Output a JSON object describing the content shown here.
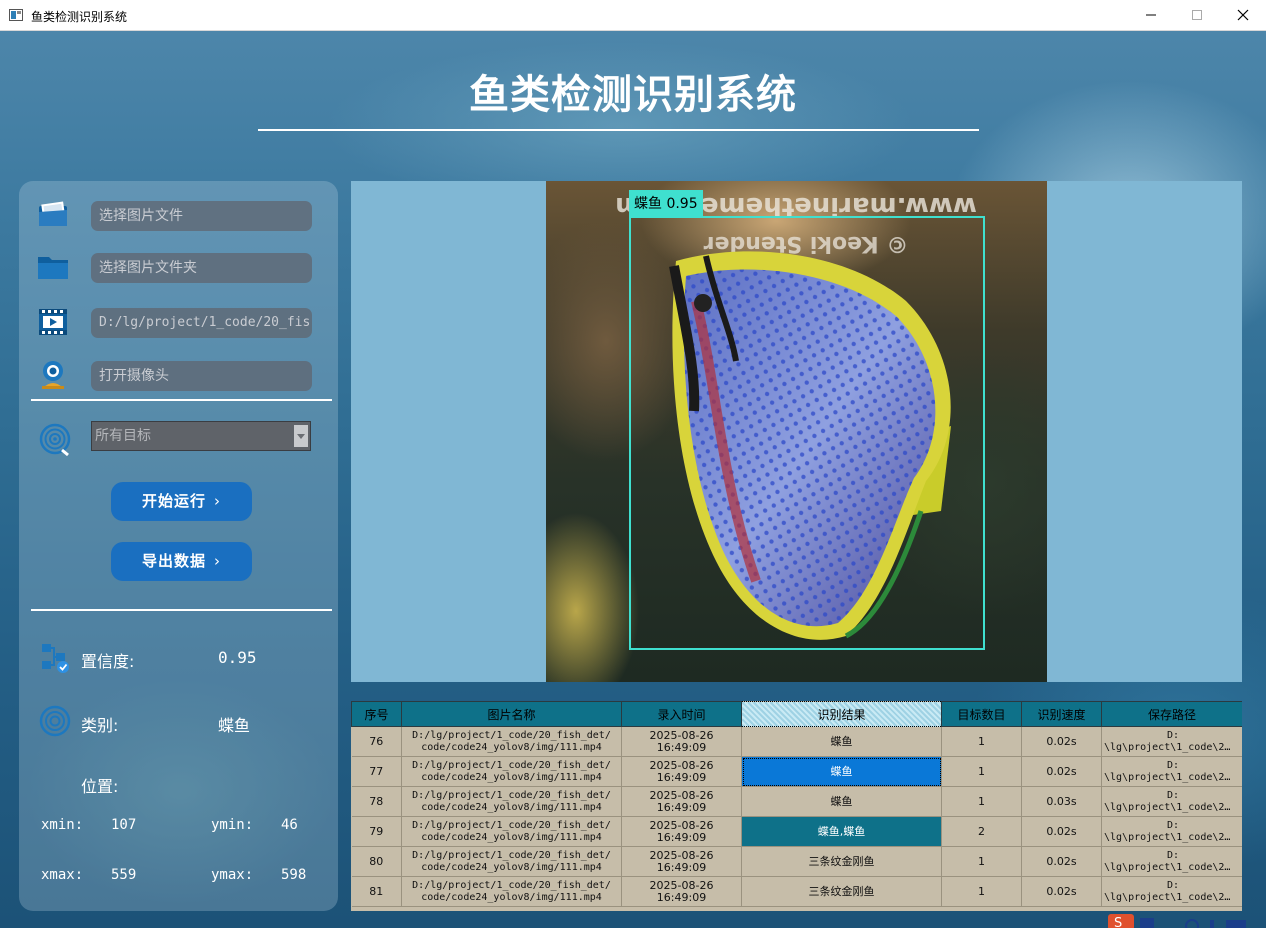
{
  "window": {
    "title": "鱼类检测识别系统"
  },
  "header": {
    "title": "鱼类检测识别系统"
  },
  "sources": {
    "image_file_placeholder": "选择图片文件",
    "image_folder_placeholder": "选择图片文件夹",
    "video_value": "D:/lg/project/1_code/20_fis",
    "camera_placeholder": "打开摄像头"
  },
  "target_select": {
    "selected": "所有目标"
  },
  "buttons": {
    "run": "开始运行",
    "export": "导出数据",
    "chevron": "›"
  },
  "result": {
    "confidence_label": "置信度:",
    "confidence_value": "0.95",
    "class_label": "类别:",
    "class_value": "蝶鱼",
    "position_label": "位置:",
    "xmin_label": "xmin:",
    "xmin_value": "107",
    "ymin_label": "ymin:",
    "ymin_value": "46",
    "xmax_label": "xmax:",
    "xmax_value": "559",
    "ymax_label": "ymax:",
    "ymax_value": "598"
  },
  "detection": {
    "label": "蝶鱼 0.95",
    "box_color": "#3fe0cf"
  },
  "image": {
    "watermark_line1": "www.marinethemes.com",
    "watermark_line2": "© Keoki Stender"
  },
  "table": {
    "columns": [
      "序号",
      "图片名称",
      "录入时间",
      "识别结果",
      "目标数目",
      "识别速度",
      "保存路径"
    ],
    "rows": [
      {
        "id": "76",
        "name_l1": "D:/lg/project/1_code/20_fish_det/",
        "name_l2": "code/code24_yolov8/img/111.mp4",
        "date": "2025-08-26",
        "time": "16:49:09",
        "result": "蝶鱼",
        "count": "1",
        "speed": "0.02s",
        "path_l1": "D:",
        "path_l2": "\\lg\\project\\1_code\\2…"
      },
      {
        "id": "77",
        "name_l1": "D:/lg/project/1_code/20_fish_det/",
        "name_l2": "code/code24_yolov8/img/111.mp4",
        "date": "2025-08-26",
        "time": "16:49:09",
        "result": "蝶鱼",
        "count": "1",
        "speed": "0.02s",
        "path_l1": "D:",
        "path_l2": "\\lg\\project\\1_code\\2…"
      },
      {
        "id": "78",
        "name_l1": "D:/lg/project/1_code/20_fish_det/",
        "name_l2": "code/code24_yolov8/img/111.mp4",
        "date": "2025-08-26",
        "time": "16:49:09",
        "result": "蝶鱼",
        "count": "1",
        "speed": "0.03s",
        "path_l1": "D:",
        "path_l2": "\\lg\\project\\1_code\\2…"
      },
      {
        "id": "79",
        "name_l1": "D:/lg/project/1_code/20_fish_det/",
        "name_l2": "code/code24_yolov8/img/111.mp4",
        "date": "2025-08-26",
        "time": "16:49:09",
        "result": "蝶鱼,蝶鱼",
        "count": "2",
        "speed": "0.02s",
        "path_l1": "D:",
        "path_l2": "\\lg\\project\\1_code\\2…"
      },
      {
        "id": "80",
        "name_l1": "D:/lg/project/1_code/20_fish_det/",
        "name_l2": "code/code24_yolov8/img/111.mp4",
        "date": "2025-08-26",
        "time": "16:49:09",
        "result": "三条纹金刚鱼",
        "count": "1",
        "speed": "0.02s",
        "path_l1": "D:",
        "path_l2": "\\lg\\project\\1_code\\2…"
      },
      {
        "id": "81",
        "name_l1": "D:/lg/project/1_code/20_fish_det/",
        "name_l2": "code/code24_yolov8/img/111.mp4",
        "date": "2025-08-26",
        "time": "16:49:09",
        "result": "三条纹金刚鱼",
        "count": "1",
        "speed": "0.02s",
        "path_l1": "D:",
        "path_l2": "\\lg\\project\\1_code\\2…"
      }
    ]
  },
  "colors": {
    "accent_button": "#1a6fc0",
    "table_header": "#0e7189",
    "table_body": "#c6bda9",
    "selection_blue": "#0a78d7",
    "display_bg": "#80b7d4"
  },
  "icons": {
    "app": "app-window-icon",
    "image_file": "image-folder-icon",
    "folder": "folder-icon",
    "video": "video-icon",
    "camera": "webcam-icon",
    "target": "target-icon",
    "confidence": "flowchart-check-icon",
    "class": "concentric-circles-icon"
  }
}
